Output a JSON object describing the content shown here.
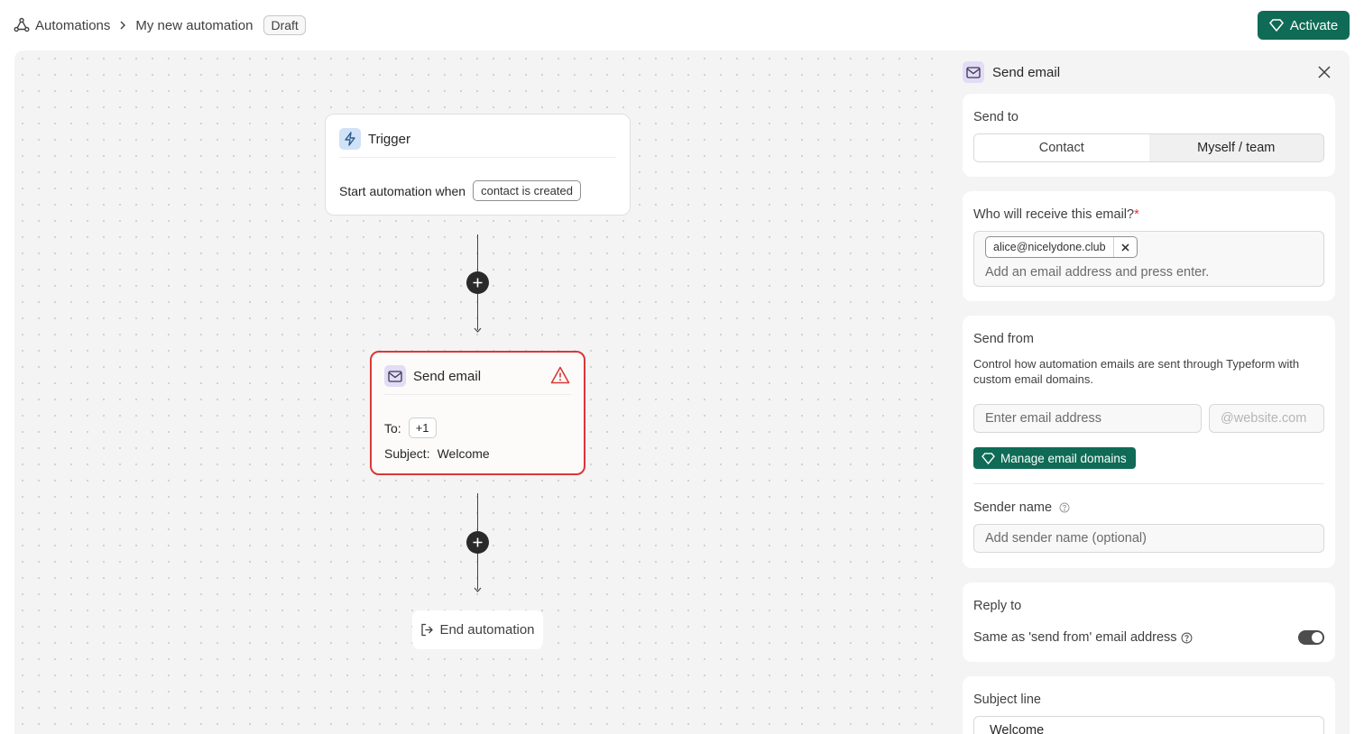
{
  "header": {
    "breadcrumb": [
      "Automations",
      "My new automation"
    ],
    "status_badge": "Draft",
    "activate_label": "Activate"
  },
  "canvas": {
    "trigger": {
      "title": "Trigger",
      "prefix": "Start automation when",
      "condition": "contact is created"
    },
    "email_node": {
      "title": "Send email",
      "to_label": "To:",
      "to_value": "+1",
      "subject_label": "Subject:",
      "subject_value": "Welcome"
    },
    "end_label": "End automation"
  },
  "panel": {
    "title": "Send email",
    "send_to": {
      "label": "Send to",
      "options": [
        "Contact",
        "Myself / team"
      ],
      "selected": "Myself / team"
    },
    "recipients": {
      "label": "Who will receive this email?",
      "required_mark": "*",
      "tags": [
        "alice@nicelydone.club"
      ],
      "placeholder": "Add an email address and press enter."
    },
    "send_from": {
      "label": "Send from",
      "description": "Control how automation emails are sent through Typeform with custom email domains.",
      "email_placeholder": "Enter email address",
      "domain_placeholder": "@website.com",
      "manage_label": "Manage email domains",
      "sender_name_label": "Sender name",
      "sender_name_placeholder": "Add sender name (optional)"
    },
    "reply_to": {
      "label": "Reply to",
      "option_text": "Same as 'send from' email address",
      "enabled": true
    },
    "subject": {
      "label": "Subject line",
      "value": "Welcome"
    }
  },
  "colors": {
    "accent": "#0f6b55",
    "error": "#d93838"
  }
}
